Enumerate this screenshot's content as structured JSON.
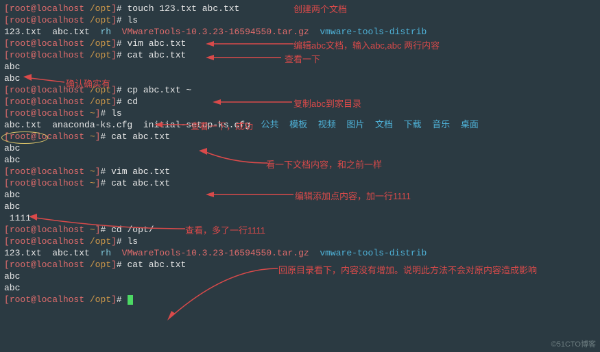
{
  "prompt": {
    "user_host_open": "[",
    "user_host": "root@localhost",
    "dir_opt": "/opt",
    "dir_home": "~",
    "close": "]",
    "hash": "#"
  },
  "cmds": {
    "touch": "touch 123.txt abc.txt",
    "ls": "ls",
    "vim_abc": "vim abc.txt",
    "cat_abc": "cat abc.txt",
    "cp_home": "cp abc.txt ~",
    "cd": "cd",
    "cd_opt": "cd /opt/"
  },
  "ls_opt": {
    "f1": "123.txt",
    "f2": "abc.txt",
    "f3": "rh",
    "tar": "VMwareTools-10.3.23-16594550.tar.gz",
    "dir": "vmware-tools-distrib"
  },
  "ls_home": {
    "f1": "abc.txt",
    "f2": "anaconda-ks.cfg",
    "f3": "initial-setup-ks.cfg",
    "d1": "公共",
    "d2": "模板",
    "d3": "视频",
    "d4": "图片",
    "d5": "文档",
    "d6": "下载",
    "d7": "音乐",
    "d8": "桌面"
  },
  "outputs": {
    "abc": "abc",
    "line1111": " 1111"
  },
  "annotations": {
    "a1": "创建两个文档",
    "a2": "编辑abc文档，输入abc,abc 两行内容",
    "a3": "查看一下",
    "a4": "确认确实有",
    "a5": "复制abc到家目录",
    "a6": "查看一下，成功",
    "a7": "看一下文档内容，和之前一样",
    "a8": "编辑添加点内容，加一行1111",
    "a9": "查看，多了一行1111",
    "a10": "回原目录看下，内容没有增加。说明此方法不会对原内容造成影响"
  },
  "watermark": "©51CTO博客"
}
